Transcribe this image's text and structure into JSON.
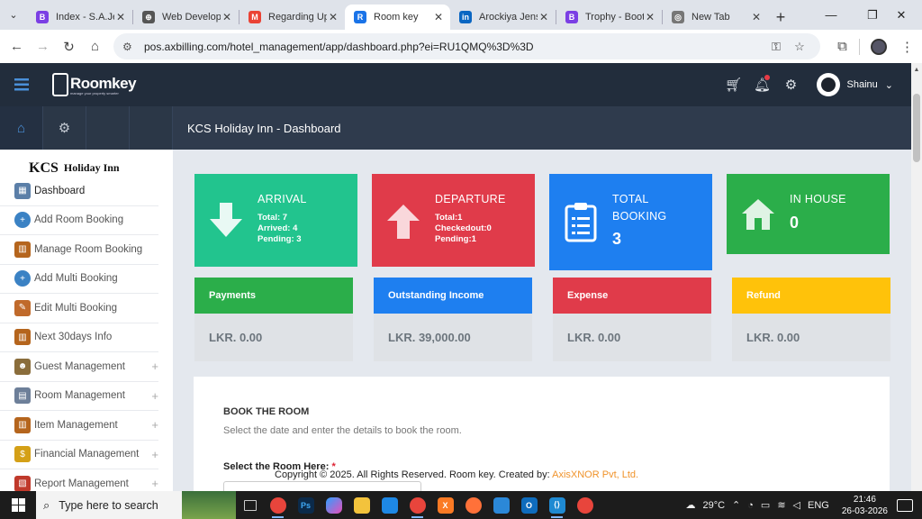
{
  "browser": {
    "tabs": [
      {
        "label": "Index - S.A.Jen",
        "icon_color": "#7b3fe4",
        "icon_text": "B"
      },
      {
        "label": "Web Develope",
        "icon_color": "#555555",
        "icon_text": "⊕"
      },
      {
        "label": "Regarding Up",
        "icon_color": "#ea4335",
        "icon_text": "M"
      },
      {
        "label": "Room key",
        "icon_color": "#1a73e8",
        "icon_text": "R",
        "active": true
      },
      {
        "label": "Arockiya Jens",
        "icon_color": "#0a66c2",
        "icon_text": "in"
      },
      {
        "label": "Trophy - Boot",
        "icon_color": "#7b3fe4",
        "icon_text": "B"
      },
      {
        "label": "New Tab",
        "icon_color": "#777777",
        "icon_text": "◎"
      }
    ],
    "url": "pos.axbilling.com/hotel_management/app/dashboard.php?ei=RU1QMQ%3D%3D"
  },
  "header": {
    "logo_text": "Roomkey",
    "logo_tagline": "manage your property smarter",
    "user_name": "Shainu"
  },
  "subheader": {
    "title": "KCS Holiday Inn - Dashboard"
  },
  "sidebar": {
    "brand_kcs": "KCS",
    "brand_name": "Holiday Inn",
    "items": [
      {
        "label": "Dashboard",
        "icon": "dashboard-icon"
      },
      {
        "label": "Add Room Booking",
        "icon": "add-circle-icon"
      },
      {
        "label": "Manage Room Booking",
        "icon": "hotel-building-icon"
      },
      {
        "label": "Add Multi Booking",
        "icon": "add-circle-icon"
      },
      {
        "label": "Edit Multi Booking",
        "icon": "edit-document-icon"
      },
      {
        "label": "Next 30days Info",
        "icon": "hotel-building-icon"
      },
      {
        "label": "Guest Management",
        "icon": "guests-icon",
        "expandable": true
      },
      {
        "label": "Room Management",
        "icon": "room-icon",
        "expandable": true
      },
      {
        "label": "Item Management",
        "icon": "hotel-building-icon",
        "expandable": true
      },
      {
        "label": "Financial Management",
        "icon": "finance-icon",
        "expandable": true
      },
      {
        "label": "Report Management",
        "icon": "report-icon",
        "expandable": true
      }
    ]
  },
  "stats": {
    "arrival": {
      "title": "ARRIVAL",
      "line1": "Total: 7",
      "line2": "Arrived: 4",
      "line3": "Pending: 3",
      "color": "#22c48e"
    },
    "departure": {
      "title": "DEPARTURE",
      "line1": "Total:1",
      "line2": "Checkedout:0",
      "line3": "Pending:1",
      "color": "#e03b4a"
    },
    "total_booking": {
      "title_line1": "TOTAL",
      "title_line2": "BOOKING",
      "value": "3",
      "color": "#1e7ff0"
    },
    "in_house": {
      "title": "IN HOUSE",
      "value": "0",
      "color": "#2bae4a"
    }
  },
  "finance": {
    "payments": {
      "label": "Payments",
      "value": "LKR. 0.00",
      "color": "#2bae4a"
    },
    "outstanding": {
      "label": "Outstanding Income",
      "value": "LKR. 39,000.00",
      "color": "#1e7ff0"
    },
    "expense": {
      "label": "Expense",
      "value": "LKR. 0.00",
      "color": "#e03b4a"
    },
    "refund": {
      "label": "Refund",
      "value": "LKR. 0.00",
      "color": "#ffc20a"
    }
  },
  "booking": {
    "title": "BOOK THE ROOM",
    "subtitle": "Select the date and enter the details to book the room.",
    "room_label": "Select the Room Here:",
    "required_mark": "*"
  },
  "footer": {
    "text": "Copyright © 2025. All Rights Reserved. Room key. Created by:",
    "link": "AxisXNOR Pvt, Ltd."
  },
  "taskbar": {
    "search_placeholder": "Type here to search",
    "weather": "29°C",
    "language": "ENG",
    "time": "21:46",
    "date": "26-03-2026"
  }
}
